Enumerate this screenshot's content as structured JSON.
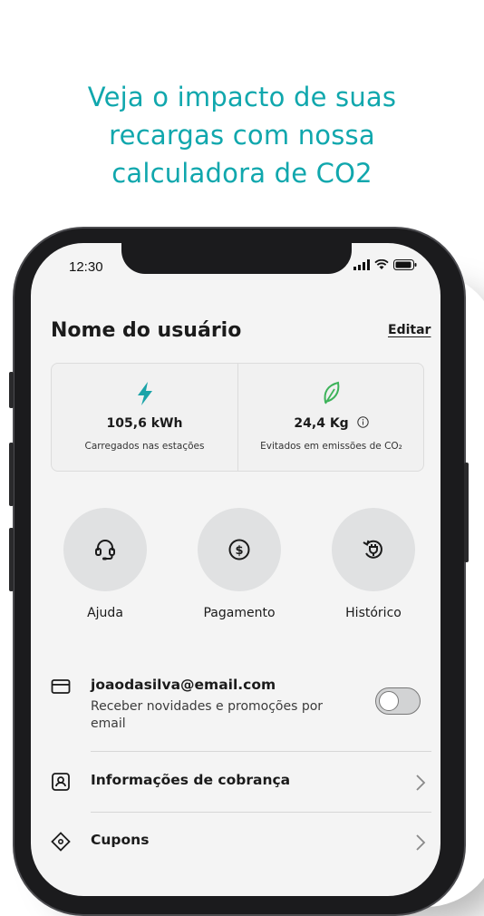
{
  "headline": {
    "line1": "Veja o impacto de suas",
    "line2": "recargas com nossa",
    "line3": "calculadora de CO2"
  },
  "status_bar": {
    "time": "12:30",
    "icons": [
      "signal-icon",
      "wifi-icon",
      "battery-icon"
    ]
  },
  "profile": {
    "name": "Nome do usuário",
    "edit_label": "Editar"
  },
  "stats": {
    "charged": {
      "value": "105,6 kWh",
      "caption": "Carregados nas estações",
      "icon": "lightning-icon"
    },
    "avoided": {
      "value": "24,4 Kg",
      "caption": "Evitados em emissões de CO₂",
      "icon": "leaf-icon",
      "info_icon": "info-icon"
    }
  },
  "quick_actions": [
    {
      "label": "Ajuda",
      "icon": "headset-icon"
    },
    {
      "label": "Pagamento",
      "icon": "dollar-coin-icon"
    },
    {
      "label": "Histórico",
      "icon": "plug-history-icon"
    }
  ],
  "menu": {
    "email": {
      "title": "joaodasilva@email.com",
      "subtitle": "Receber novidades e promoções por email",
      "toggle_on": false,
      "icon": "card-icon"
    },
    "billing": {
      "title": "Informações de cobrança",
      "icon": "id-badge-icon"
    },
    "coupons": {
      "title": "Cupons",
      "icon": "ticket-icon"
    }
  },
  "colors": {
    "accent": "#10a7ad",
    "lightning": "#1aa3a8",
    "leaf": "#3db35a",
    "screen_bg": "#f4f4f4",
    "quick_circle": "#e0e1e2"
  }
}
